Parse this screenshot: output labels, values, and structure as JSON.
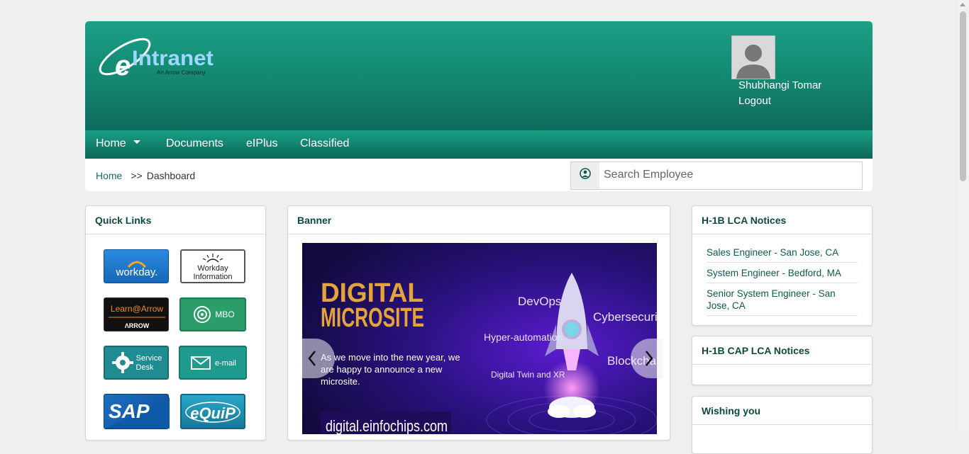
{
  "header": {
    "logo": {
      "text": "eIntranet",
      "tagline": "An Arrow Company"
    },
    "user": {
      "name": "Shubhangi Tomar",
      "logout_label": "Logout"
    }
  },
  "nav": {
    "items": [
      {
        "label": "Home",
        "has_dropdown": true
      },
      {
        "label": "Documents"
      },
      {
        "label": "eIPlus"
      },
      {
        "label": "Classified"
      }
    ]
  },
  "breadcrumb": {
    "home": "Home",
    "separator": ">>",
    "current": "Dashboard"
  },
  "search": {
    "placeholder": "Search Employee"
  },
  "quick_links": {
    "title": "Quick Links",
    "tiles": [
      {
        "name": "workday",
        "label": "workday."
      },
      {
        "name": "workday-information",
        "label_line1": "Workday",
        "label_line2": "Information"
      },
      {
        "name": "learn-at-arrow",
        "label_line1": "Learn@Arrow",
        "label_line2": "ΛRROW"
      },
      {
        "name": "mbo",
        "label": "MBO"
      },
      {
        "name": "service-desk",
        "label_line1": "Service",
        "label_line2": "Desk"
      },
      {
        "name": "e-mail",
        "label": "e-mail"
      },
      {
        "name": "sap",
        "label": "SAP"
      },
      {
        "name": "equip",
        "label": "eQuiP"
      }
    ]
  },
  "banner": {
    "title": "Banner",
    "slide": {
      "heading_line1": "DIGITAL",
      "heading_line2": "MICROSITE",
      "body_line1": "As we move into the new year, we",
      "body_line2": "are happy to announce a new",
      "body_line3": "microsite.",
      "url": "digital.einfochips.com",
      "tags": [
        "DevOps",
        "Cybersecurity",
        "Hyper-automation",
        "Blockchain",
        "Digital Twin and XR"
      ]
    }
  },
  "h1b_lca": {
    "title": "H-1B LCA Notices",
    "items": [
      "Sales Engineer - San Jose, CA",
      "System Engineer - Bedford, MA",
      "Senior System Engineer - San Jose, CA"
    ]
  },
  "h1b_cap_lca": {
    "title": "H-1B CAP LCA Notices"
  },
  "wishing": {
    "title": "Wishing you"
  },
  "colors": {
    "brand_teal": "#13866f",
    "dark_teal": "#0c6656",
    "link": "#0c6f63"
  }
}
